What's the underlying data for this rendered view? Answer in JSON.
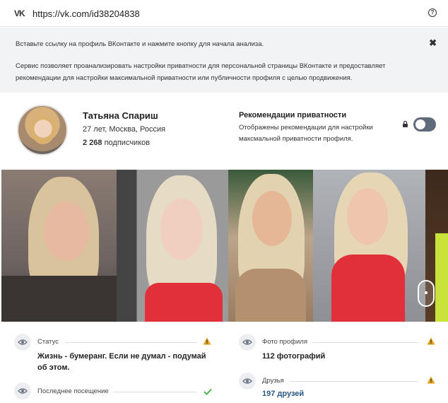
{
  "urlbar": {
    "logo": "VK",
    "url": "https://vk.com/id38204838",
    "help_icon": "?"
  },
  "banner": {
    "hint": "Вставьте ссылку на профиль ВКонтакте и нажмите кнопку для начала анализа.",
    "description": "Сервис позволяет проанализировать настройки приватности для персональной страницы ВКонтакте и предоставляет рекомендации для настройки максимальной приватности или публичности профиля с целью продвижения.",
    "close_icon": "✖"
  },
  "profile": {
    "name": "Татьяна Спариш",
    "meta": "27 лет, Москва, Россия",
    "subscribers_count": "2 268",
    "subscribers_label": "подписчиков"
  },
  "privacy": {
    "title": "Рекомендации приватности",
    "text": "Отображены рекомендации для настройки максмальной приватности профиля.",
    "toggle_on": false
  },
  "details": {
    "status": {
      "label": "Статус",
      "value": "Жизнь - бумеранг. Если не думал - подумай об этом.",
      "state": "warning"
    },
    "last_seen": {
      "label": "Последнее посещение",
      "state": "ok"
    },
    "profile_photos": {
      "label": "Фото профиля",
      "value": "112 фотографий",
      "state": "warning"
    },
    "friends": {
      "label": "Друзья",
      "value": "197 друзей",
      "state": "warning"
    }
  },
  "colors": {
    "warning": "#e3a21a",
    "ok": "#4bb34b",
    "link": "#2a5885",
    "toggle": "#5f6b7a"
  }
}
